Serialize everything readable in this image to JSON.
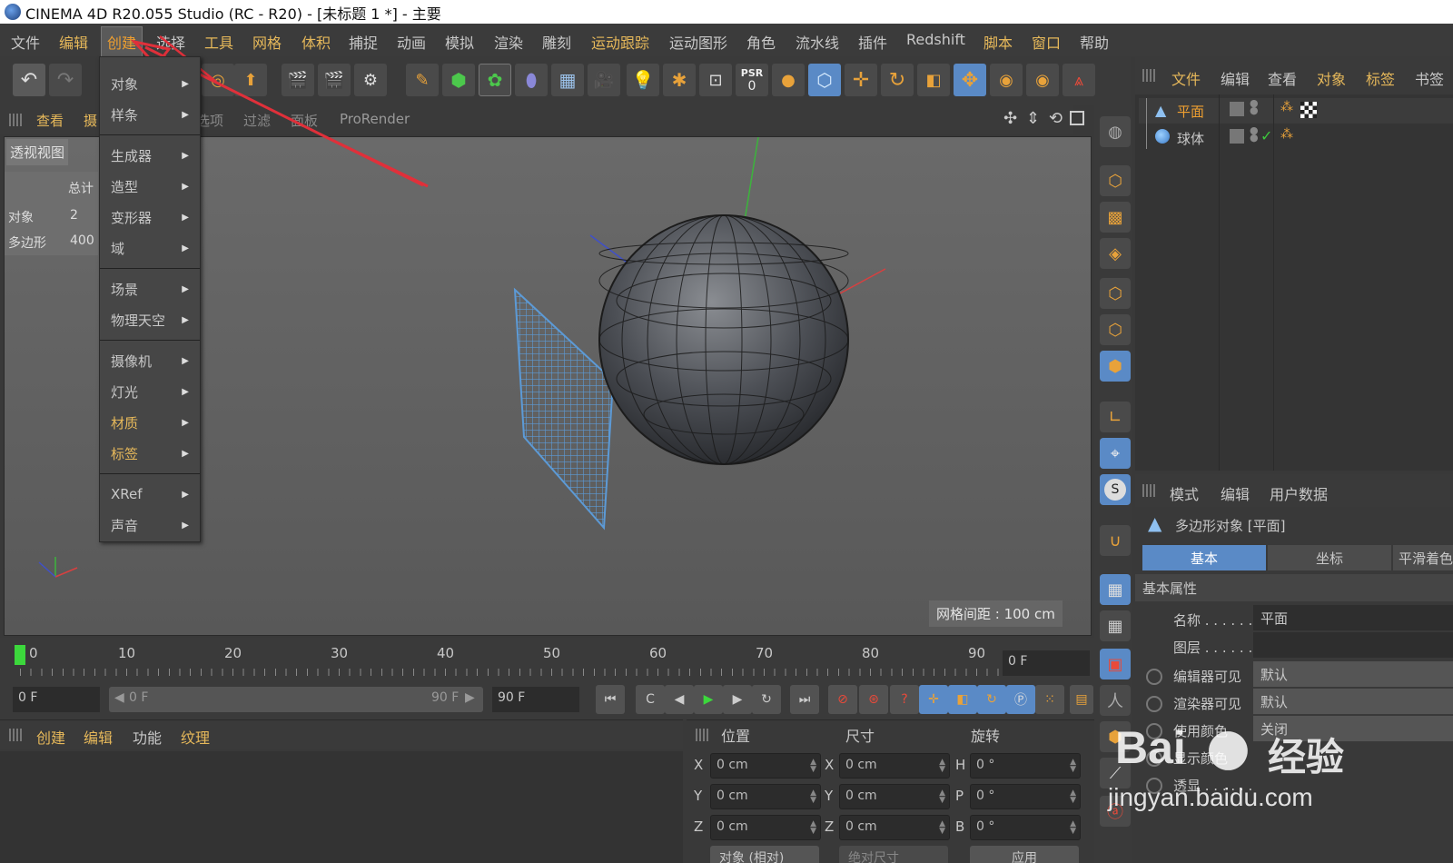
{
  "window": {
    "title": "CINEMA 4D R20.055 Studio (RC - R20) - [未标题 1 *] - 主要"
  },
  "menubar": [
    "文件",
    "编辑",
    "创建",
    "选择",
    "工具",
    "网格",
    "体积",
    "捕捉",
    "动画",
    "模拟",
    "渲染",
    "雕刻",
    "运动跟踪",
    "运动图形",
    "角色",
    "流水线",
    "插件",
    "Redshift",
    "脚本",
    "窗口",
    "帮助"
  ],
  "create_menu": {
    "groups": [
      [
        "对象",
        "样条"
      ],
      [
        "生成器",
        "造型",
        "变形器",
        "域"
      ],
      [
        "场景",
        "物理天空"
      ],
      [
        "摄像机",
        "灯光",
        "材质",
        "标签"
      ],
      [
        "XRef",
        "声音"
      ]
    ]
  },
  "viewport": {
    "menu": [
      "查看",
      "摄",
      "选项",
      "过滤",
      "面板",
      "ProRender"
    ],
    "view_name": "透视视图",
    "stats": {
      "header": "总计",
      "rows": [
        {
          "label": "对象",
          "value": "2"
        },
        {
          "label": "多边形",
          "value": "400"
        }
      ]
    },
    "grid_spacing": "网格间距 : 100 cm"
  },
  "toolbar": {
    "psr_label": "PSR",
    "psr_value": "0"
  },
  "object_manager": {
    "menu": [
      "文件",
      "编辑",
      "查看",
      "对象",
      "标签",
      "书签"
    ],
    "objects": [
      {
        "name": "平面"
      },
      {
        "name": "球体"
      }
    ]
  },
  "attributes": {
    "menu": [
      "模式",
      "编辑",
      "用户数据"
    ],
    "object_title": "多边形对象 [平面]",
    "tabs": [
      "基本",
      "坐标",
      "平滑着色"
    ],
    "section": "基本属性",
    "rows": [
      {
        "label": "名称 . . . . . .",
        "value": "平面"
      },
      {
        "label": "图层 . . . . . .",
        "value": ""
      },
      {
        "label": "编辑器可见",
        "value": "默认"
      },
      {
        "label": "渲染器可见",
        "value": "默认"
      },
      {
        "label": "使用颜色",
        "value": "关闭"
      },
      {
        "label": "显示颜色",
        "value": ""
      },
      {
        "label": "透显 . . . . . .",
        "value": ""
      }
    ]
  },
  "timeline": {
    "ticks": [
      "0",
      "10",
      "20",
      "30",
      "40",
      "50",
      "60",
      "70",
      "80",
      "90"
    ],
    "current_frame": "0 F",
    "start_frame": "0 F",
    "range_start": "0 F",
    "range_end": "90 F",
    "end_frame": "90 F"
  },
  "material_manager": {
    "menu": [
      "创建",
      "编辑",
      "功能",
      "纹理"
    ]
  },
  "coordinates": {
    "headers": [
      "位置",
      "尺寸",
      "旋转"
    ],
    "rows": [
      {
        "axis": "X",
        "pos": "0 cm",
        "size_axis": "X",
        "size": "0 cm",
        "rot_axis": "H",
        "rot": "0 °"
      },
      {
        "axis": "Y",
        "pos": "0 cm",
        "size_axis": "Y",
        "size": "0 cm",
        "rot_axis": "P",
        "rot": "0 °"
      },
      {
        "axis": "Z",
        "pos": "0 cm",
        "size_axis": "Z",
        "size": "0 cm",
        "rot_axis": "B",
        "rot": "0 °"
      }
    ],
    "mode_select": "对象 (相对)",
    "size_select": "绝对尺寸",
    "apply_label": "应用"
  },
  "watermark": {
    "brand": "Bai",
    "brand2": "经验",
    "url": "jingyan.baidu.com"
  },
  "colors": {
    "accent": "#e8a23a",
    "menu_highlight": "#f0a030",
    "annotation_arrow": "#e0303a",
    "plane_mesh": "#5c9ad6",
    "selection_tab": "#5a8ac6"
  }
}
